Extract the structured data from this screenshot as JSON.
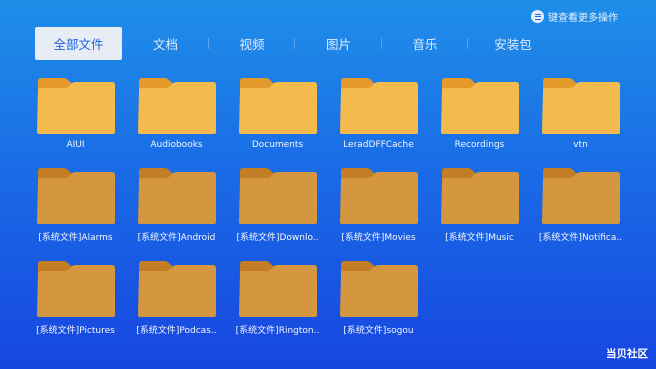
{
  "hint": {
    "icon": "menu-icon",
    "text": "键查看更多操作"
  },
  "tabs": [
    {
      "label": "全部文件",
      "active": true
    },
    {
      "label": "文档",
      "active": false
    },
    {
      "label": "视频",
      "active": false
    },
    {
      "label": "图片",
      "active": false
    },
    {
      "label": "音乐",
      "active": false
    },
    {
      "label": "安装包",
      "active": false
    }
  ],
  "files": [
    {
      "name": "AIUI",
      "style": "user"
    },
    {
      "name": "Audiobooks",
      "style": "user"
    },
    {
      "name": "Documents",
      "style": "user"
    },
    {
      "name": "LeradDFFCache",
      "style": "user"
    },
    {
      "name": "Recordings",
      "style": "user"
    },
    {
      "name": "vtn",
      "style": "user"
    },
    {
      "name": "[系统文件]Alarms",
      "style": "system"
    },
    {
      "name": "[系统文件]Android",
      "style": "system"
    },
    {
      "name": "[系统文件]Downlo..",
      "style": "system"
    },
    {
      "name": "[系统文件]Movies",
      "style": "system"
    },
    {
      "name": "[系统文件]Music",
      "style": "system"
    },
    {
      "name": "[系统文件]Notifica..",
      "style": "system"
    },
    {
      "name": "[系统文件]Pictures",
      "style": "system"
    },
    {
      "name": "[系统文件]Podcas..",
      "style": "system"
    },
    {
      "name": "[系统文件]Rington..",
      "style": "system"
    },
    {
      "name": "[系统文件]sogou",
      "style": "system"
    }
  ],
  "colors": {
    "user_back": "#e39a2a",
    "user_front": "#f3bb4e",
    "system_back": "#c27d25",
    "system_front": "#d4963e"
  },
  "watermark": "当贝社区"
}
